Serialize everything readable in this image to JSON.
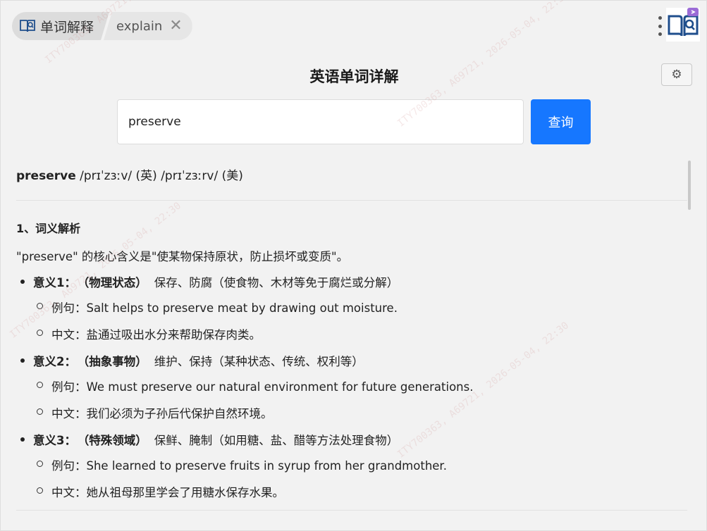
{
  "header": {
    "app_name": "单词解释",
    "tab_label": "explain",
    "close_glyph": "✕"
  },
  "page_title": "英语单词详解",
  "settings_glyph": "⚙",
  "search": {
    "value": "preserve",
    "button_label": "查询"
  },
  "result": {
    "word": "preserve",
    "pron_uk": "/prɪˈzɜːv/",
    "uk_tag": "(英)",
    "pron_us": "/prɪˈzɜːrv/",
    "us_tag": "(美)",
    "section_title": "1、词义解析",
    "core_meaning": "\"preserve\" 的核心含义是\"使某物保持原状，防止损坏或变质\"。",
    "meanings": [
      {
        "label": "意义1：",
        "category": "（物理状态）",
        "definition": "保存、防腐（使食物、木材等免于腐烂或分解）",
        "example": "例句：Salt helps to preserve meat by drawing out moisture.",
        "translation": "中文：盐通过吸出水分来帮助保存肉类。"
      },
      {
        "label": "意义2：",
        "category": "（抽象事物）",
        "definition": "维护、保持（某种状态、传统、权利等）",
        "example": "例句：We must preserve our natural environment for future generations.",
        "translation": "中文：我们必须为子孙后代保护自然环境。"
      },
      {
        "label": "意义3：",
        "category": "（特殊领域）",
        "definition": "保鲜、腌制（如用糖、盐、醋等方法处理食物）",
        "example": "例句：She learned to preserve fruits in syrup from her grandmother.",
        "translation": "中文：她从祖母那里学会了用糖水保存水果。"
      }
    ]
  },
  "watermark": "ITY700363, A69721, 2026-05-04, 22:30",
  "colors": {
    "accent": "#1677ff",
    "background": "#f2f2f2"
  }
}
